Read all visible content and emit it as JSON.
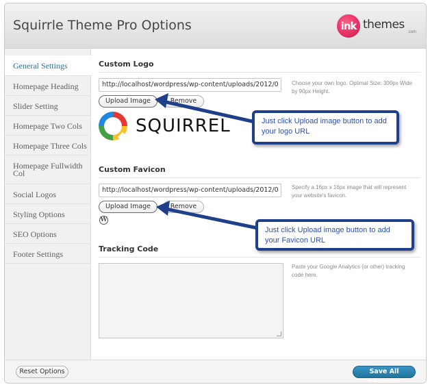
{
  "header": {
    "title": "Squirrle Theme Pro Options",
    "brand": {
      "badge": "ink",
      "word": "themes",
      "suffix": ".com"
    }
  },
  "sidebar": {
    "items": [
      {
        "label": "General Settings",
        "active": true
      },
      {
        "label": "Homepage Heading"
      },
      {
        "label": "Slider Setting"
      },
      {
        "label": "Homepage Two Cols"
      },
      {
        "label": "Homepage Three Cols"
      },
      {
        "label": "Homepage Fullwidth Col"
      },
      {
        "label": "Social Logos"
      },
      {
        "label": "Styling Options"
      },
      {
        "label": "SEO Options"
      },
      {
        "label": "Footer Settings"
      }
    ]
  },
  "custom_logo": {
    "title": "Custom Logo",
    "url_value": "http://localhost/wordpress/wp-content/uploads/2012/0",
    "help": "Choose your own logo. Optimal Size: 300px Wide by 90px Height.",
    "upload_label": "Upload Image",
    "remove_label": "Remove",
    "preview_text": "SQUIRREL",
    "callout": "Just click Upload image button to add your logo URL"
  },
  "custom_favicon": {
    "title": "Custom Favicon",
    "url_value": "http://localhost/wordpress/wp-content/uploads/2012/0",
    "help": "Specify a 16px x 16px image that will represent your website's favicon.",
    "upload_label": "Upload Image",
    "remove_label": "Remove",
    "preview_glyph": "W",
    "callout": "Just click Upload image button to add your Favicon URL"
  },
  "tracking": {
    "title": "Tracking Code",
    "help": "Paste your Google Analytics (or other) tracking code here.",
    "value": ""
  },
  "footer": {
    "reset_label": "Reset Options",
    "save_label": "Save All Changes"
  },
  "colors": {
    "accent": "#21759b",
    "callout_border": "#1f3f8a",
    "callout_text": "#2a50b0",
    "brand_badge": "#d0104a"
  }
}
